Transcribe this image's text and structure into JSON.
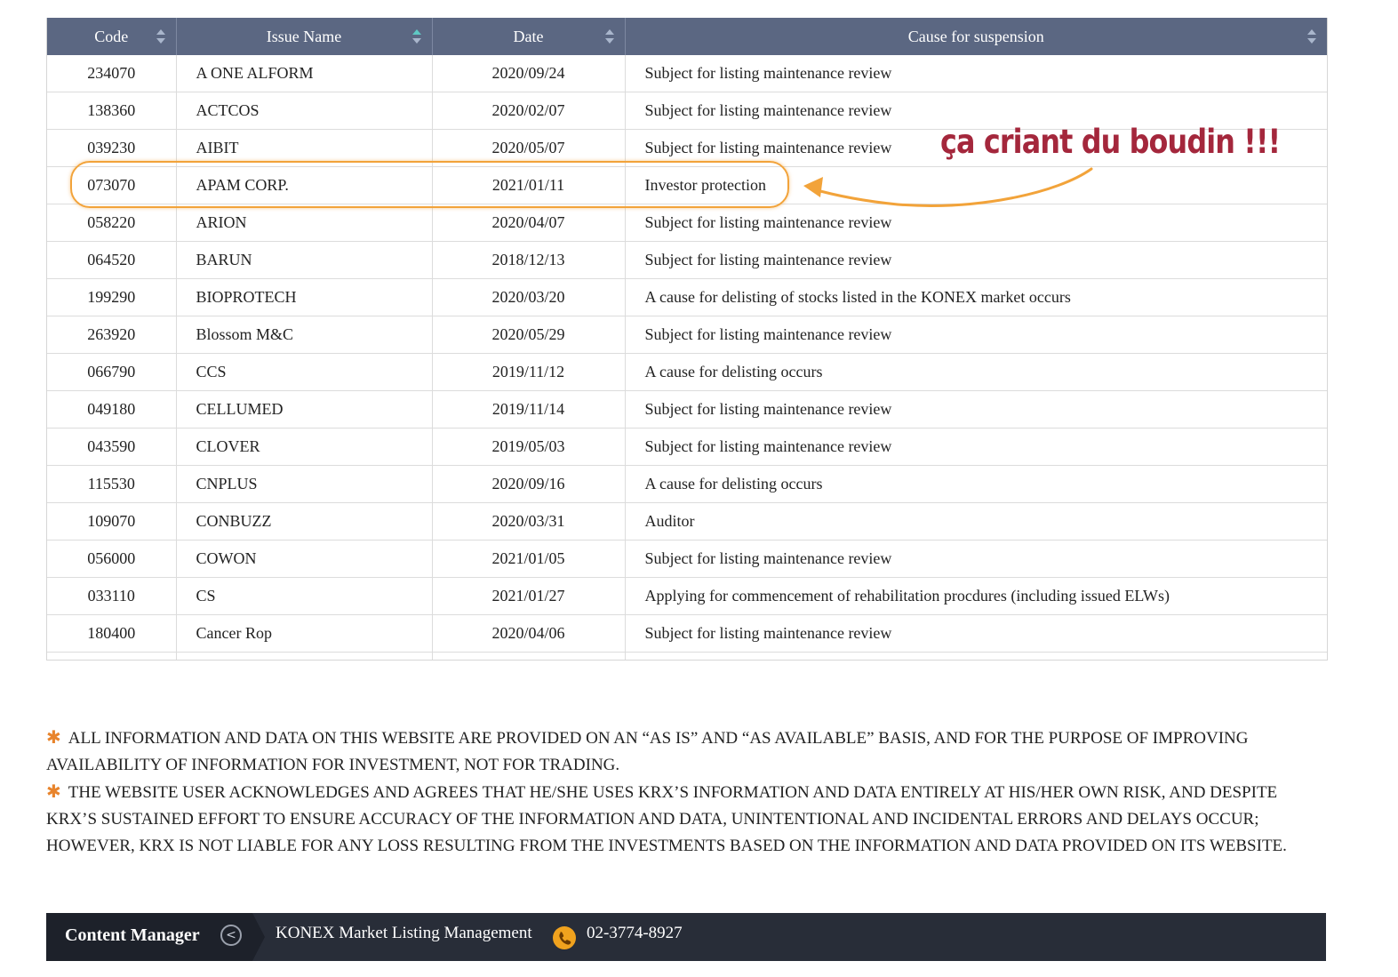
{
  "table": {
    "headers": [
      "Code",
      "Issue Name",
      "Date",
      "Cause for suspension"
    ],
    "rows": [
      [
        "234070",
        "A ONE ALFORM",
        "2020/09/24",
        "Subject for listing maintenance review"
      ],
      [
        "138360",
        "ACTCOS",
        "2020/02/07",
        "Subject for listing maintenance review"
      ],
      [
        "039230",
        "AIBIT",
        "2020/05/07",
        "Subject for listing maintenance review"
      ],
      [
        "073070",
        "APAM CORP.",
        "2021/01/11",
        "Investor protection"
      ],
      [
        "058220",
        "ARION",
        "2020/04/07",
        "Subject for listing maintenance review"
      ],
      [
        "064520",
        "BARUN",
        "2018/12/13",
        "Subject for listing maintenance review"
      ],
      [
        "199290",
        "BIOPROTECH",
        "2020/03/20",
        "A cause for delisting of stocks listed in the KONEX market occurs"
      ],
      [
        "263920",
        "Blossom M&C",
        "2020/05/29",
        "Subject for listing maintenance review"
      ],
      [
        "066790",
        "CCS",
        "2019/11/12",
        "A cause for delisting occurs"
      ],
      [
        "049180",
        "CELLUMED",
        "2019/11/14",
        "Subject for listing maintenance review"
      ],
      [
        "043590",
        "CLOVER",
        "2019/05/03",
        "Subject for listing maintenance review"
      ],
      [
        "115530",
        "CNPLUS",
        "2020/09/16",
        "A cause for delisting occurs"
      ],
      [
        "109070",
        "CONBUZZ",
        "2020/03/31",
        "Auditor"
      ],
      [
        "056000",
        "COWON",
        "2021/01/05",
        "Subject for listing maintenance review"
      ],
      [
        "033110",
        "CS",
        "2021/01/27",
        "Applying for commencement of rehabilitation procdures (including issued ELWs)"
      ],
      [
        "180400",
        "Cancer Rop",
        "2020/04/06",
        "Subject for listing maintenance review"
      ]
    ]
  },
  "annotation": {
    "text": "ça criant du boudin !!!",
    "color": "#a4273c",
    "highlight_color": "#f2a33a"
  },
  "disclaimer": {
    "items": [
      "ALL INFORMATION AND DATA ON THIS WEBSITE ARE PROVIDED ON AN “AS IS” AND “AS AVAILABLE” BASIS, AND FOR THE PURPOSE OF IMPROVING AVAILABILITY OF INFORMATION FOR INVESTMENT, NOT FOR TRADING.",
      "THE WEBSITE USER ACKNOWLEDGES AND AGREES THAT HE/SHE USES KRX’S INFORMATION AND DATA ENTIRELY AT HIS/HER OWN RISK, AND DESPITE KRX’S SUSTAINED EFFORT TO ENSURE ACCURACY OF THE INFORMATION AND DATA, UNINTENTIONAL AND INCIDENTAL ERRORS AND DELAYS OCCUR; HOWEVER, KRX IS NOT LIABLE FOR ANY LOSS RESULTING FROM THE INVESTMENTS BASED ON THE INFORMATION AND DATA PROVIDED ON ITS WEBSITE."
    ],
    "bullet": "✱"
  },
  "footer": {
    "label": "Content Manager",
    "back_icon": "chevron-left-icon",
    "manager": "KONEX Market Listing Management",
    "phone_icon": "phone-icon",
    "phone": "02-3774-8927"
  },
  "colors": {
    "header_bg": "#5b6782",
    "footer_bg": "#282d38",
    "accent_orange": "#f0a21e"
  }
}
